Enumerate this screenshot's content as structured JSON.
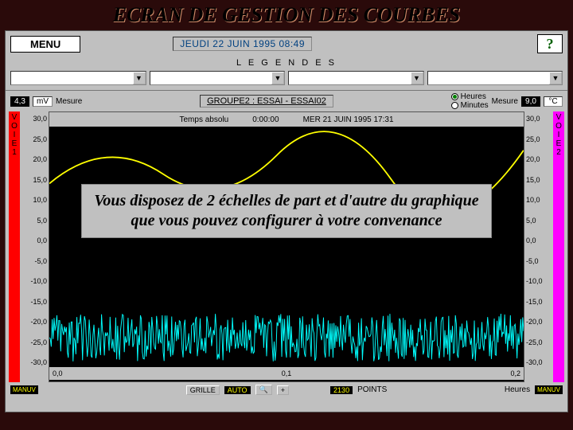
{
  "title": "ECRAN DE GESTION DES COURBES",
  "menu_label": "MENU",
  "datetime": "JEUDI 22 JUIN 1995 08:49",
  "help_label": "?",
  "legendes_label": "L E G E N D E S",
  "left": {
    "value": "4,3",
    "unit": "mV",
    "mesure": "Mesure"
  },
  "right": {
    "value": "9,0",
    "unit": "°C",
    "mesure": "Mesure"
  },
  "group_name": "GROUPE2 : ESSAI - ESSAI02",
  "time_unit": {
    "heures": "Heures",
    "minutes": "Minutes"
  },
  "voie1": [
    "V",
    "O",
    "I",
    "E",
    "1"
  ],
  "voie2": [
    "V",
    "O",
    "I",
    "E",
    "2"
  ],
  "plot_head": {
    "temps": "Temps absolu",
    "t0": "0:00:00",
    "date": "MER 21 JUIN 1995 17:31"
  },
  "y_ticks": [
    "30,0",
    "25,0",
    "20,0",
    "15,0",
    "10,0",
    "5,0",
    "0,0",
    "-5,0",
    "-10,0",
    "-15,0",
    "-20,0",
    "-25,0",
    "-30,0"
  ],
  "x_ticks": [
    "0,0",
    "0,1",
    "0,2"
  ],
  "x_unit": "Heures",
  "overlay": "Vous disposez de 2 échelles de part et d'autre du graphique que vous pouvez configurer à votre convenance",
  "manuv": "MANUV",
  "grille_btn": "GRILLE",
  "auto_btn": "AUTO",
  "points_value": "2130",
  "points_label": "POINTS",
  "zoom_plus": "+",
  "chart_data": {
    "type": "line",
    "title": "GROUPE2 : ESSAI - ESSAI02",
    "xlabel": "Heures",
    "ylabel_left": "mV",
    "ylabel_right": "°C",
    "xlim": [
      0.0,
      0.2
    ],
    "ylim_left": [
      -30,
      30
    ],
    "ylim_right": [
      -30,
      30
    ],
    "series": [
      {
        "name": "VOIE1",
        "color": "#00ffff",
        "note": "high-frequency noise band approx -14 to -30"
      },
      {
        "name": "VOIE2",
        "color": "#ffff00",
        "note": "smooth curve approx 20 to 30 range"
      }
    ]
  }
}
